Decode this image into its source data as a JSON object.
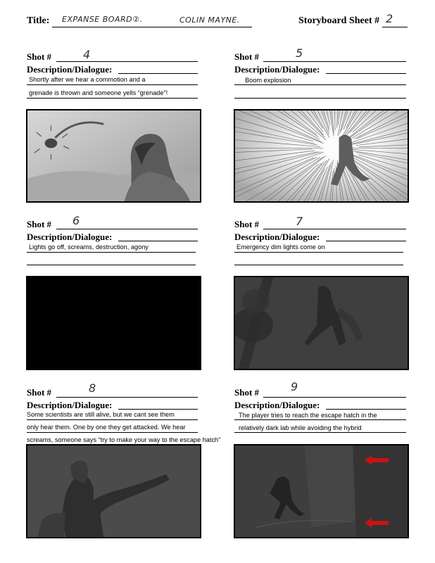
{
  "header": {
    "title_label": "Title:",
    "title_value": "EXPANSE BOARD②.",
    "author_value": "COLIN MAYNE.",
    "sheet_label": "Storyboard Sheet #",
    "sheet_number": "2"
  },
  "labels": {
    "shot": "Shot #",
    "description": "Description/Dialogue:"
  },
  "shots": [
    {
      "number": "4",
      "lines": [
        "Shortly after we hear a commotion and a",
        "grenade is thrown and someone yells “grenade”!"
      ]
    },
    {
      "number": "5",
      "lines": [
        "Boom explosion",
        ""
      ]
    },
    {
      "number": "6",
      "lines": [
        "Lights go off, screams, destruction, agony",
        ""
      ]
    },
    {
      "number": "7",
      "lines": [
        "Emergency dim lights come on",
        ""
      ]
    },
    {
      "number": "8",
      "lines": [
        "Some scientists are still alive, but we cant see them",
        "only hear them. One by one they get attacked. We hear",
        "screams, someone says “try to make your way to the escape hatch”"
      ]
    },
    {
      "number": "9",
      "lines": [
        "The player tries to reach the escape hatch in the",
        "relatively dark lab while avoiding the hybrid"
      ]
    }
  ],
  "colors": {
    "arrow": "#cc1111",
    "frame_dark": "#3d3d3d",
    "frame_black": "#000000"
  }
}
